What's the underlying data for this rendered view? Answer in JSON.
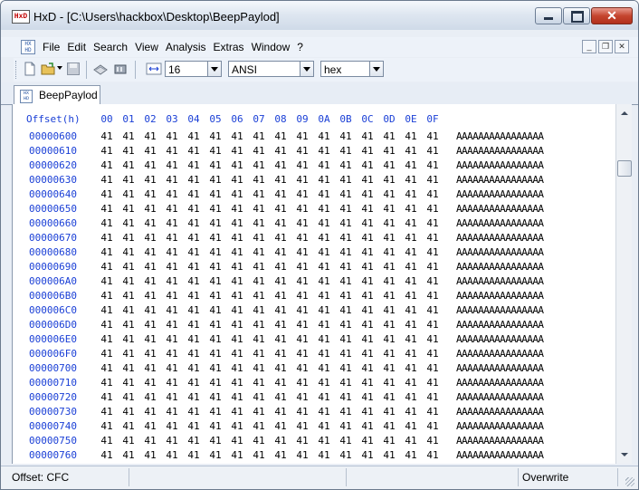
{
  "window": {
    "title": "HxD - [C:\\Users\\hackbox\\Desktop\\BeepPaylod]",
    "app_icon_text": "HxD",
    "close_glyph": "✕"
  },
  "menu": {
    "items": [
      "File",
      "Edit",
      "Search",
      "View",
      "Analysis",
      "Extras",
      "Window",
      "?"
    ]
  },
  "toolbar": {
    "bytes_per_row": "16",
    "charset": "ANSI",
    "display_mode": "hex",
    "icons": [
      "new-file-icon",
      "open-folder-icon",
      "save-disk-icon",
      "open-disk-icon",
      "open-ram-icon",
      "bytes-per-row-icon"
    ]
  },
  "tab": {
    "label": "BeepPaylod"
  },
  "hex_view": {
    "offset_header": "Offset(h)",
    "columns": [
      "00",
      "01",
      "02",
      "03",
      "04",
      "05",
      "06",
      "07",
      "08",
      "09",
      "0A",
      "0B",
      "0C",
      "0D",
      "0E",
      "0F"
    ],
    "byte_value": "41",
    "ascii_text": "AAAAAAAAAAAAAAAA",
    "rows": [
      "00000600",
      "00000610",
      "00000620",
      "00000630",
      "00000640",
      "00000650",
      "00000660",
      "00000670",
      "00000680",
      "00000690",
      "000006A0",
      "000006B0",
      "000006C0",
      "000006D0",
      "000006E0",
      "000006F0",
      "00000700",
      "00000710",
      "00000720",
      "00000730",
      "00000740",
      "00000750",
      "00000760"
    ]
  },
  "status": {
    "offset": "Offset: CFC",
    "mode": "Overwrite"
  },
  "colors": {
    "offset_blue": "#1a3fd6",
    "titlebar": "#dfe7f1",
    "close_red": "#c5452f"
  }
}
